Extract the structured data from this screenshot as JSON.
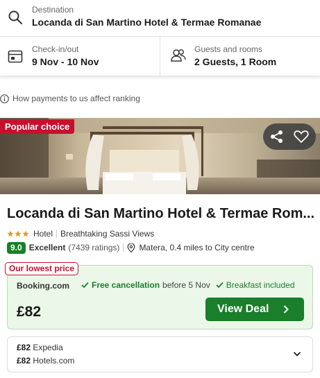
{
  "search": {
    "destination_label": "Destination",
    "destination_value": "Locanda di San Martino Hotel & Termae Romanae",
    "dates_label": "Check-in/out",
    "dates_value": "9 Nov - 10 Nov",
    "guests_label": "Guests and rooms",
    "guests_value": "2 Guests, 1 Room"
  },
  "info": {
    "text": "How payments to us affect ranking"
  },
  "hotel": {
    "badge": "Popular choice",
    "name": "Locanda di San Martino Hotel & Termae Rom...",
    "stars": 3,
    "type": "Hotel",
    "tagline": "Breathtaking Sassi Views",
    "score": "9.0",
    "rating_word": "Excellent",
    "ratings_count": "(7439 ratings)",
    "location": "Matera, 0.4 miles to City centre"
  },
  "deal": {
    "lowest_label": "Our lowest price",
    "provider": "Booking.com",
    "free_cancel": "Free cancellation",
    "cancel_before": "before 5 Nov",
    "breakfast": "Breakfast included",
    "price": "£82",
    "button": "View Deal"
  },
  "other_offers": [
    {
      "price": "£82",
      "provider": "Expedia"
    },
    {
      "price": "£82",
      "provider": "Hotels.com"
    }
  ],
  "colors": {
    "accent_green": "#1a7e2a",
    "badge_red": "#c8102e"
  }
}
